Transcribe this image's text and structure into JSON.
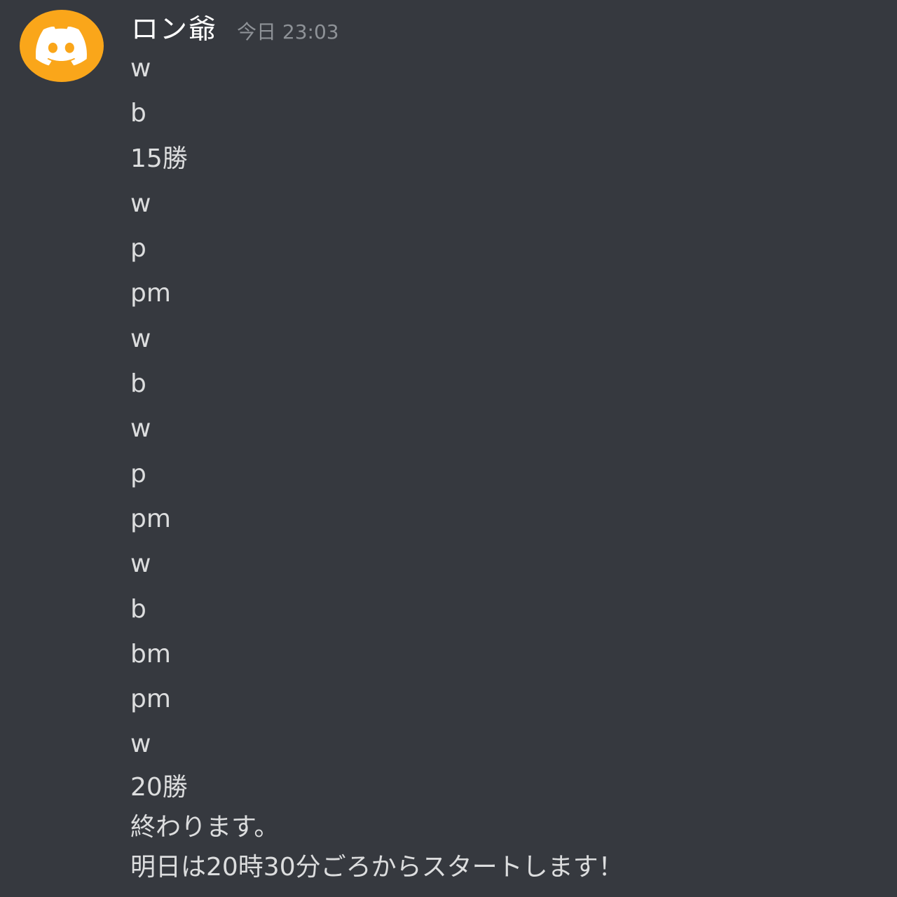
{
  "message": {
    "avatar_icon": "discord-logo-icon",
    "avatar_color": "#faa61a",
    "username": "ロン爺",
    "timestamp": "今日 23:03",
    "lines": [
      "w",
      "b",
      "15勝",
      "w",
      "p",
      "pm",
      "w",
      "b",
      "w",
      "p",
      "pm",
      "w",
      "b",
      "bm",
      "pm",
      "w",
      "20勝",
      "終わります。",
      "明日は20時30分ごろからスタートします！"
    ]
  }
}
